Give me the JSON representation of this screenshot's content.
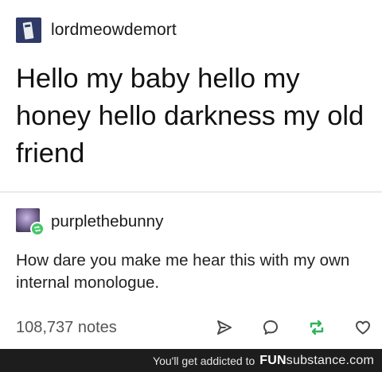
{
  "post": {
    "op": {
      "username": "lordmeowdemort",
      "text": "Hello my baby hello my honey hello darkness my old friend"
    },
    "reply": {
      "username": "purplethebunny",
      "text": "How dare you make me hear this with my own internal monologue."
    },
    "footer": {
      "notes": "108,737 notes",
      "icons": [
        "share-icon",
        "reply-icon",
        "reblog-icon",
        "like-icon"
      ]
    }
  },
  "watermark": {
    "text": "You'll get addicted to",
    "brand_bold": "FUN",
    "brand_light": "substance",
    "brand_suffix": ".com"
  },
  "colors": {
    "reblog_green": "#44c767",
    "watermark_bg": "#1d1d1d",
    "text": "#222222"
  }
}
